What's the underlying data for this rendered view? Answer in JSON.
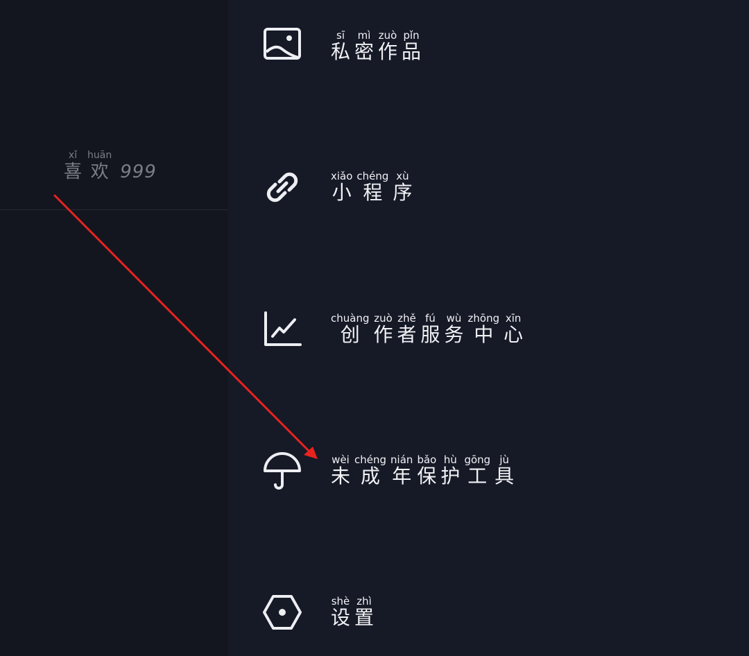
{
  "profile": {
    "likes": {
      "chars": [
        {
          "hanzi": "喜",
          "pinyin": "xǐ"
        },
        {
          "hanzi": "欢",
          "pinyin": "huān"
        }
      ],
      "count": "999"
    }
  },
  "menu": {
    "items": [
      {
        "icon": "image-icon",
        "chars": [
          {
            "hanzi": "私",
            "pinyin": "sī"
          },
          {
            "hanzi": "密",
            "pinyin": "mì"
          },
          {
            "hanzi": "作",
            "pinyin": "zuò"
          },
          {
            "hanzi": "品",
            "pinyin": "pǐn"
          }
        ]
      },
      {
        "icon": "link-icon",
        "chars": [
          {
            "hanzi": "小",
            "pinyin": "xiǎo"
          },
          {
            "hanzi": "程",
            "pinyin": "chéng"
          },
          {
            "hanzi": "序",
            "pinyin": "xù"
          }
        ]
      },
      {
        "icon": "chart-icon",
        "chars": [
          {
            "hanzi": "创",
            "pinyin": "chuàng"
          },
          {
            "hanzi": "作",
            "pinyin": "zuò"
          },
          {
            "hanzi": "者",
            "pinyin": "zhě"
          },
          {
            "hanzi": "服",
            "pinyin": "fú"
          },
          {
            "hanzi": "务",
            "pinyin": "wù"
          },
          {
            "hanzi": "中",
            "pinyin": "zhōng"
          },
          {
            "hanzi": "心",
            "pinyin": "xīn"
          }
        ]
      },
      {
        "icon": "umbrella-icon",
        "chars": [
          {
            "hanzi": "未",
            "pinyin": "wèi"
          },
          {
            "hanzi": "成",
            "pinyin": "chéng"
          },
          {
            "hanzi": "年",
            "pinyin": "nián"
          },
          {
            "hanzi": "保",
            "pinyin": "bǎo"
          },
          {
            "hanzi": "护",
            "pinyin": "hù"
          },
          {
            "hanzi": "工",
            "pinyin": "gōng"
          },
          {
            "hanzi": "具",
            "pinyin": "jù"
          }
        ]
      },
      {
        "icon": "settings-hexagon-icon",
        "chars": [
          {
            "hanzi": "设",
            "pinyin": "shè"
          },
          {
            "hanzi": "置",
            "pinyin": "zhì"
          }
        ]
      }
    ]
  },
  "colors": {
    "background": "#161822",
    "drawer": "#161926",
    "text": "#f1f2f5",
    "muted_text": "#7b7d87",
    "annotation_arrow": "#e8231f"
  }
}
